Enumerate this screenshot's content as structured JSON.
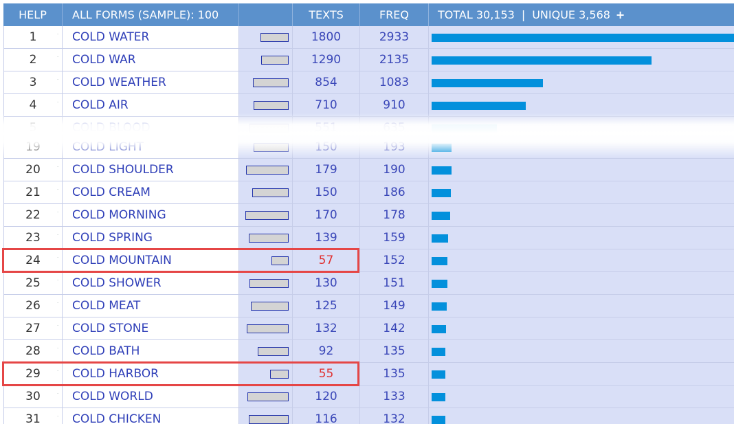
{
  "header": {
    "help": "HELP",
    "forms": "ALL FORMS  (SAMPLE):  100",
    "texts": "TEXTS",
    "freq": "FREQ",
    "total": "TOTAL 30,153",
    "sep": "|",
    "unique": "UNIQUE 3,568",
    "plus": "+"
  },
  "max_freq": 2933,
  "max_texts": 1800,
  "rows": [
    {
      "n": "1",
      "form": "COLD WATER",
      "texts": "1800",
      "freq": "2933"
    },
    {
      "n": "2",
      "form": "COLD WAR",
      "texts": "1290",
      "freq": "2135"
    },
    {
      "n": "3",
      "form": "COLD WEATHER",
      "texts": "854",
      "freq": "1083"
    },
    {
      "n": "4",
      "form": "COLD AIR",
      "texts": "710",
      "freq": "910"
    },
    {
      "n": "5",
      "form": "COLD BLOOD",
      "texts": "551",
      "freq": "635"
    },
    {
      "n": "19",
      "form": "COLD LIGHT",
      "texts": "150",
      "freq": "193"
    },
    {
      "n": "20",
      "form": "COLD SHOULDER",
      "texts": "179",
      "freq": "190"
    },
    {
      "n": "21",
      "form": "COLD CREAM",
      "texts": "150",
      "freq": "186"
    },
    {
      "n": "22",
      "form": "COLD MORNING",
      "texts": "170",
      "freq": "178"
    },
    {
      "n": "23",
      "form": "COLD SPRING",
      "texts": "139",
      "freq": "159"
    },
    {
      "n": "24",
      "form": "COLD MOUNTAIN",
      "texts": "57",
      "freq": "152",
      "highlight": true
    },
    {
      "n": "25",
      "form": "COLD SHOWER",
      "texts": "130",
      "freq": "151"
    },
    {
      "n": "26",
      "form": "COLD MEAT",
      "texts": "125",
      "freq": "149"
    },
    {
      "n": "27",
      "form": "COLD STONE",
      "texts": "132",
      "freq": "142"
    },
    {
      "n": "28",
      "form": "COLD BATH",
      "texts": "92",
      "freq": "135"
    },
    {
      "n": "29",
      "form": "COLD HARBOR",
      "texts": "55",
      "freq": "135",
      "highlight": true
    },
    {
      "n": "30",
      "form": "COLD WORLD",
      "texts": "120",
      "freq": "133"
    },
    {
      "n": "31",
      "form": "COLD CHICKEN",
      "texts": "116",
      "freq": "132"
    }
  ],
  "colors": {
    "header_bg": "#5b91cc",
    "cell_bg": "#d9dff7",
    "bar": "#0390dc",
    "highlight_border": "#e54646",
    "highlight_text": "#e03030",
    "link": "#2f3fb8"
  }
}
